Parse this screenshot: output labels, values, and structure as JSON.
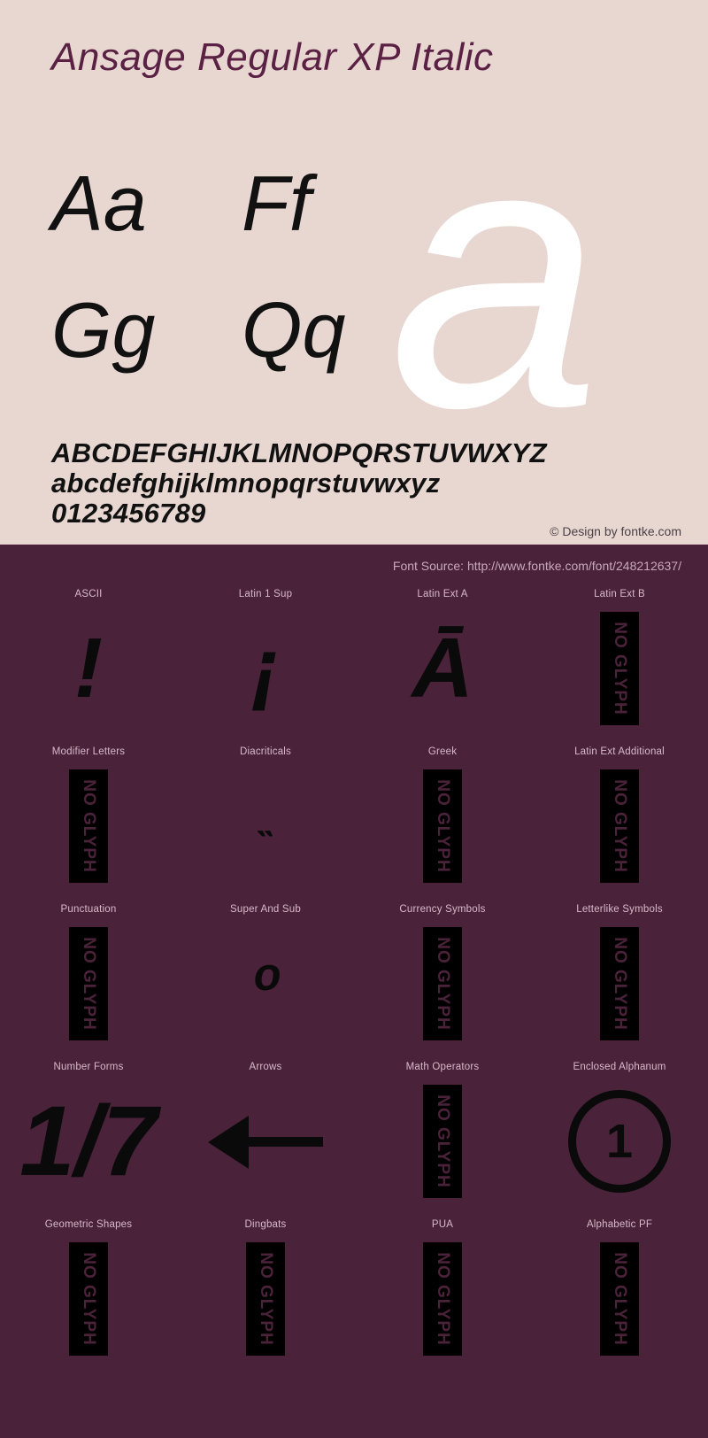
{
  "theme": {
    "top_background": "#e8d7d1",
    "bottom_background": "#4a2239",
    "title_color": "#5b2144",
    "glyph_color": "#0a0a0a",
    "label_color": "#d8b9cc",
    "watermark_color": "#ffffff"
  },
  "header": {
    "title": "Ansage Regular XP Italic"
  },
  "watermark": {
    "char": "a"
  },
  "samples": [
    {
      "left": "Aa",
      "right": "Ff"
    },
    {
      "left": "Gg",
      "right": "Qq"
    }
  ],
  "alphabet": {
    "uppercase": "ABCDEFGHIJKLMNOPQRSTUVWXYZ",
    "lowercase": "abcdefghijklmnopqrstuvwxyz",
    "digits": "0123456789"
  },
  "credit": "© Design by fontke.com",
  "font_source": "Font Source: http://www.fontke.com/font/248212637/",
  "no_glyph_label": "NO GLYPH",
  "glyph_blocks": [
    [
      {
        "label": "ASCII",
        "type": "char",
        "char": "!",
        "size": "glyph-char"
      },
      {
        "label": "Latin 1 Sup",
        "type": "char",
        "char": "¡",
        "size": "glyph-char"
      },
      {
        "label": "Latin Ext A",
        "type": "char",
        "char": "Ā",
        "size": "glyph-char"
      },
      {
        "label": "Latin Ext B",
        "type": "noglyph",
        "char": "",
        "size": "glyph-char"
      }
    ],
    [
      {
        "label": "Modifier Letters",
        "type": "noglyph",
        "char": "",
        "size": "glyph-char"
      },
      {
        "label": "Diacriticals",
        "type": "char",
        "char": "˵",
        "size": "glyph-char tiny"
      },
      {
        "label": "Greek",
        "type": "noglyph",
        "char": "",
        "size": "glyph-char"
      },
      {
        "label": "Latin Ext Additional",
        "type": "noglyph",
        "char": "",
        "size": "glyph-char"
      }
    ],
    [
      {
        "label": "Punctuation",
        "type": "noglyph",
        "char": "",
        "size": "glyph-char"
      },
      {
        "label": "Super And Sub",
        "type": "char",
        "char": "ᵒ",
        "size": "glyph-char small"
      },
      {
        "label": "Currency Symbols",
        "type": "noglyph",
        "char": "",
        "size": "glyph-char"
      },
      {
        "label": "Letterlike Symbols",
        "type": "noglyph",
        "char": "",
        "size": "glyph-char"
      }
    ],
    [
      {
        "label": "Number Forms",
        "type": "char",
        "char": "1/7",
        "size": "glyph-char big"
      },
      {
        "label": "Arrows",
        "type": "arrow",
        "char": "←",
        "size": "glyph-char"
      },
      {
        "label": "Math Operators",
        "type": "noglyph",
        "char": "",
        "size": "glyph-char"
      },
      {
        "label": "Enclosed Alphanum",
        "type": "circled",
        "char": "1",
        "size": "glyph-char"
      }
    ],
    [
      {
        "label": "Geometric Shapes",
        "type": "noglyph",
        "char": "",
        "size": "glyph-char"
      },
      {
        "label": "Dingbats",
        "type": "noglyph",
        "char": "",
        "size": "glyph-char"
      },
      {
        "label": "PUA",
        "type": "noglyph",
        "char": "",
        "size": "glyph-char"
      },
      {
        "label": "Alphabetic PF",
        "type": "noglyph",
        "char": "",
        "size": "glyph-char"
      }
    ]
  ]
}
